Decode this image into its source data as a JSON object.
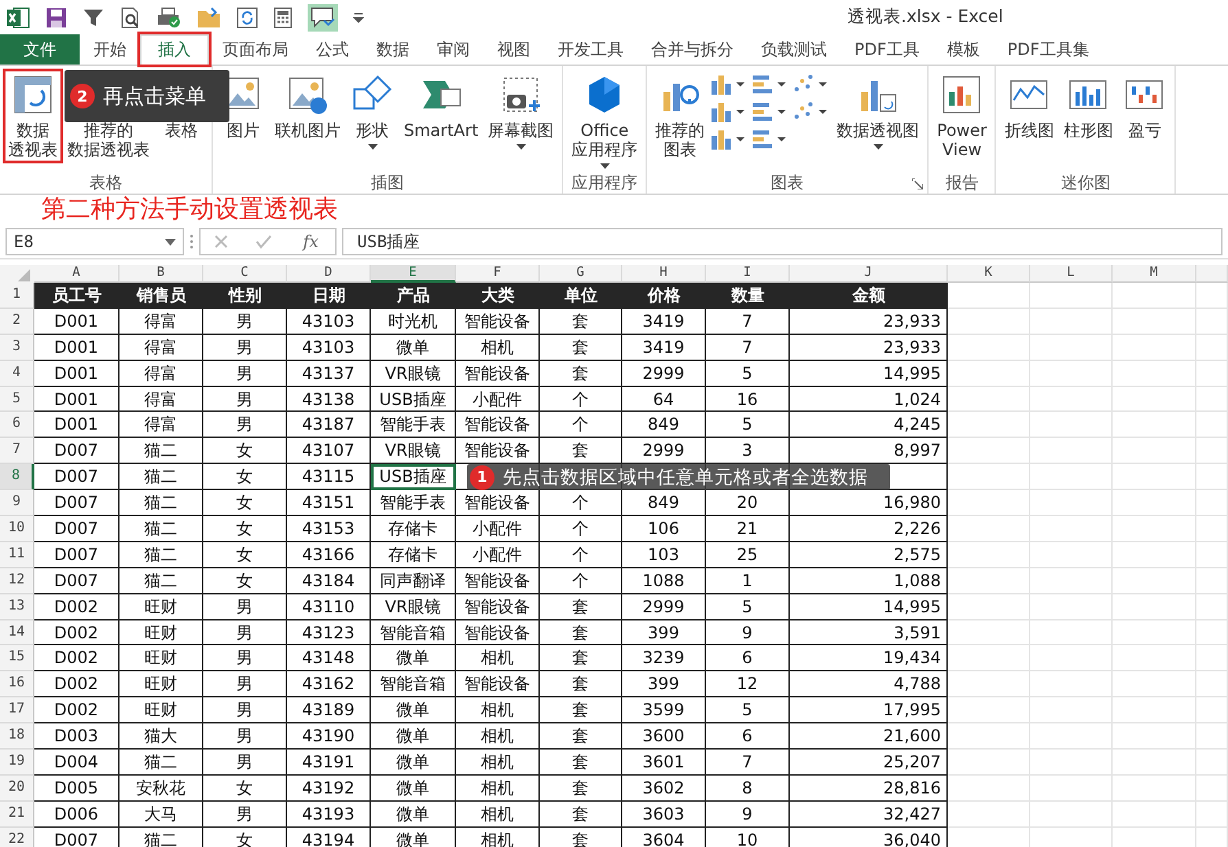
{
  "window": {
    "title": "透视表.xlsx - Excel"
  },
  "ribbon_tabs": [
    {
      "label": "文件",
      "kind": "file",
      "selected": false,
      "highlighted": false
    },
    {
      "label": "开始",
      "kind": "tab",
      "selected": false,
      "highlighted": false
    },
    {
      "label": "插入",
      "kind": "tab",
      "selected": true,
      "highlighted": true
    },
    {
      "label": "页面布局",
      "kind": "tab",
      "selected": false,
      "highlighted": false
    },
    {
      "label": "公式",
      "kind": "tab",
      "selected": false,
      "highlighted": false
    },
    {
      "label": "数据",
      "kind": "tab",
      "selected": false,
      "highlighted": false
    },
    {
      "label": "审阅",
      "kind": "tab",
      "selected": false,
      "highlighted": false
    },
    {
      "label": "视图",
      "kind": "tab",
      "selected": false,
      "highlighted": false
    },
    {
      "label": "开发工具",
      "kind": "tab",
      "selected": false,
      "highlighted": false
    },
    {
      "label": "合并与拆分",
      "kind": "tab",
      "selected": false,
      "highlighted": false
    },
    {
      "label": "负载测试",
      "kind": "tab",
      "selected": false,
      "highlighted": false
    },
    {
      "label": "PDF工具",
      "kind": "tab",
      "selected": false,
      "highlighted": false
    },
    {
      "label": "模板",
      "kind": "tab",
      "selected": false,
      "highlighted": false
    },
    {
      "label": "PDF工具集",
      "kind": "tab",
      "selected": false,
      "highlighted": false
    }
  ],
  "ribbon_groups": [
    {
      "label": "表格",
      "buttons": [
        {
          "kind": "large",
          "lines": [
            "数据",
            "透视表"
          ],
          "highlighted": true
        },
        {
          "kind": "large",
          "lines": [
            "推荐的",
            "数据透视表"
          ],
          "highlighted": false,
          "icon_covered": true
        },
        {
          "kind": "large",
          "lines": [
            "表格"
          ],
          "highlighted": false,
          "icon_covered": true
        }
      ]
    },
    {
      "label": "插图",
      "buttons": [
        {
          "kind": "large",
          "lines": [
            "图片"
          ],
          "highlighted": false
        },
        {
          "kind": "large",
          "lines": [
            "联机图片"
          ],
          "highlighted": false
        },
        {
          "kind": "large",
          "lines": [
            "形状"
          ],
          "dropdown": true,
          "highlighted": false
        },
        {
          "kind": "large",
          "lines": [
            "SmartArt"
          ],
          "highlighted": false
        },
        {
          "kind": "large",
          "lines": [
            "屏幕截图"
          ],
          "dropdown": true,
          "highlighted": false
        }
      ]
    },
    {
      "label": "应用程序",
      "buttons": [
        {
          "kind": "large",
          "lines": [
            "Office",
            "应用程序"
          ],
          "dropdown": true,
          "highlighted": false
        }
      ]
    },
    {
      "label": "图表",
      "launcher": true,
      "buttons": [
        {
          "kind": "large",
          "lines": [
            "推荐的",
            "图表"
          ],
          "highlighted": false
        },
        {
          "kind": "icon_grid"
        },
        {
          "kind": "large",
          "lines": [
            "数据透视图"
          ],
          "dropdown": true,
          "highlighted": false
        }
      ]
    },
    {
      "label": "报告",
      "buttons": [
        {
          "kind": "large",
          "lines": [
            "Power",
            "View"
          ],
          "highlighted": false
        }
      ]
    },
    {
      "label": "迷你图",
      "buttons": [
        {
          "kind": "large",
          "lines": [
            "折线图"
          ],
          "highlighted": false
        },
        {
          "kind": "large",
          "lines": [
            "柱形图"
          ],
          "highlighted": false
        },
        {
          "kind": "large",
          "lines": [
            "盈亏"
          ],
          "highlighted": false
        }
      ]
    }
  ],
  "note": "第二种方法手动设置透视表",
  "formula_bar": {
    "name_box": "E8",
    "function_label": "fx",
    "value": "USB插座"
  },
  "columns": [
    {
      "label": "A",
      "selected": false
    },
    {
      "label": "B",
      "selected": false
    },
    {
      "label": "C",
      "selected": false
    },
    {
      "label": "D",
      "selected": false
    },
    {
      "label": "E",
      "selected": true
    },
    {
      "label": "F",
      "selected": false
    },
    {
      "label": "G",
      "selected": false
    },
    {
      "label": "H",
      "selected": false
    },
    {
      "label": "I",
      "selected": false
    },
    {
      "label": "J",
      "selected": false
    },
    {
      "label": "K",
      "selected": false
    },
    {
      "label": "L",
      "selected": false
    },
    {
      "label": "M",
      "selected": false
    }
  ],
  "header_row": {
    "number": "1",
    "cells": [
      "员工号",
      "销售员",
      "性别",
      "日期",
      "产品",
      "大类",
      "单位",
      "价格",
      "数量",
      "金额"
    ]
  },
  "rows": [
    {
      "number": "2",
      "selected": false,
      "cells": [
        "D001",
        "得富",
        "男",
        "43103",
        "时光机",
        "智能设备",
        "套",
        "3419",
        "7",
        "23,933"
      ]
    },
    {
      "number": "3",
      "selected": false,
      "cells": [
        "D001",
        "得富",
        "男",
        "43103",
        "微单",
        "相机",
        "套",
        "3419",
        "7",
        "23,933"
      ]
    },
    {
      "number": "4",
      "selected": false,
      "cells": [
        "D001",
        "得富",
        "男",
        "43137",
        "VR眼镜",
        "智能设备",
        "套",
        "2999",
        "5",
        "14,995"
      ]
    },
    {
      "number": "5",
      "selected": false,
      "cells": [
        "D001",
        "得富",
        "男",
        "43138",
        "USB插座",
        "小配件",
        "个",
        "64",
        "16",
        "1,024"
      ]
    },
    {
      "number": "6",
      "selected": false,
      "cells": [
        "D001",
        "得富",
        "男",
        "43187",
        "智能手表",
        "智能设备",
        "个",
        "849",
        "5",
        "4,245"
      ]
    },
    {
      "number": "7",
      "selected": false,
      "cells": [
        "D007",
        "猫二",
        "女",
        "43107",
        "VR眼镜",
        "智能设备",
        "套",
        "2999",
        "3",
        "8,997"
      ]
    },
    {
      "number": "8",
      "selected": true,
      "cells": [
        "D007",
        "猫二",
        "女",
        "43115",
        "USB插座"
      ]
    },
    {
      "number": "9",
      "selected": false,
      "cells": [
        "D007",
        "猫二",
        "女",
        "43151",
        "智能手表",
        "智能设备",
        "个",
        "849",
        "20",
        "16,980"
      ]
    },
    {
      "number": "10",
      "selected": false,
      "cells": [
        "D007",
        "猫二",
        "女",
        "43153",
        "存储卡",
        "小配件",
        "个",
        "106",
        "21",
        "2,226"
      ]
    },
    {
      "number": "11",
      "selected": false,
      "cells": [
        "D007",
        "猫二",
        "女",
        "43166",
        "存储卡",
        "小配件",
        "个",
        "103",
        "25",
        "2,575"
      ]
    },
    {
      "number": "12",
      "selected": false,
      "cells": [
        "D007",
        "猫二",
        "女",
        "43184",
        "同声翻译",
        "智能设备",
        "个",
        "1088",
        "1",
        "1,088"
      ]
    },
    {
      "number": "13",
      "selected": false,
      "cells": [
        "D002",
        "旺财",
        "男",
        "43110",
        "VR眼镜",
        "智能设备",
        "套",
        "2999",
        "5",
        "14,995"
      ]
    },
    {
      "number": "14",
      "selected": false,
      "cells": [
        "D002",
        "旺财",
        "男",
        "43123",
        "智能音箱",
        "智能设备",
        "套",
        "399",
        "9",
        "3,591"
      ]
    },
    {
      "number": "15",
      "selected": false,
      "cells": [
        "D002",
        "旺财",
        "男",
        "43148",
        "微单",
        "相机",
        "套",
        "3239",
        "6",
        "19,434"
      ]
    },
    {
      "number": "16",
      "selected": false,
      "cells": [
        "D002",
        "旺财",
        "男",
        "43162",
        "智能音箱",
        "智能设备",
        "套",
        "399",
        "12",
        "4,788"
      ]
    },
    {
      "number": "17",
      "selected": false,
      "cells": [
        "D002",
        "旺财",
        "男",
        "43189",
        "微单",
        "相机",
        "套",
        "3599",
        "5",
        "17,995"
      ]
    },
    {
      "number": "18",
      "selected": false,
      "cells": [
        "D003",
        "猫大",
        "男",
        "43190",
        "微单",
        "相机",
        "套",
        "3600",
        "6",
        "21,600"
      ]
    },
    {
      "number": "19",
      "selected": false,
      "cells": [
        "D004",
        "猫二",
        "男",
        "43191",
        "微单",
        "相机",
        "套",
        "3601",
        "7",
        "25,207"
      ]
    },
    {
      "number": "20",
      "selected": false,
      "cells": [
        "D005",
        "安秋花",
        "女",
        "43192",
        "微单",
        "相机",
        "套",
        "3602",
        "8",
        "28,816"
      ]
    },
    {
      "number": "21",
      "selected": false,
      "cells": [
        "D006",
        "大马",
        "男",
        "43193",
        "微单",
        "相机",
        "套",
        "3603",
        "9",
        "32,427"
      ]
    },
    {
      "number": "22",
      "selected": false,
      "cells": [
        "D007",
        "猫二",
        "女",
        "43194",
        "微单",
        "相机",
        "套",
        "3604",
        "10",
        "36,040"
      ]
    }
  ],
  "ribbon_callout": {
    "number": "2",
    "text": "再点击菜单"
  },
  "sheet_callout": {
    "number": "1",
    "text": "先点击数据区域中任意单元格或者全选数据"
  }
}
